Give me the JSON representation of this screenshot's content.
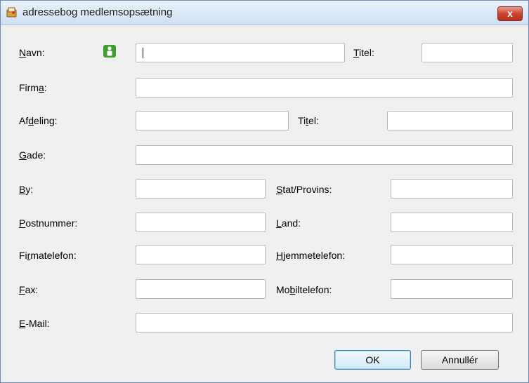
{
  "window": {
    "title": "adressebog medlemsopsætning",
    "close_label": "x"
  },
  "colors": {
    "titlebar": "#cfe0f3",
    "close": "#c9462f",
    "person_icon": "#3f9e2f",
    "ok_focus": "#3c7fb1"
  },
  "icons": {
    "app": "address-book-icon",
    "person": "person-icon"
  },
  "form": {
    "navn": {
      "label_pre": "",
      "label_key": "N",
      "label_post": "avn:",
      "value": ""
    },
    "titel1": {
      "label_pre": "",
      "label_key": "T",
      "label_post": "itel:",
      "value": ""
    },
    "firma": {
      "label_pre": "Firm",
      "label_key": "a",
      "label_post": ":",
      "value": ""
    },
    "afdeling": {
      "label_pre": "Af",
      "label_key": "d",
      "label_post": "eling:",
      "value": ""
    },
    "titel2": {
      "label_pre": "Ti",
      "label_key": "t",
      "label_post": "el:",
      "value": ""
    },
    "gade": {
      "label_pre": "",
      "label_key": "G",
      "label_post": "ade:",
      "value": ""
    },
    "by": {
      "label_pre": "",
      "label_key": "B",
      "label_post": "y:",
      "value": ""
    },
    "stat": {
      "label_pre": "",
      "label_key": "S",
      "label_post": "tat/Provins:",
      "value": ""
    },
    "postnummer": {
      "label_pre": "",
      "label_key": "P",
      "label_post": "ostnummer:",
      "value": ""
    },
    "land": {
      "label_pre": "",
      "label_key": "L",
      "label_post": "and:",
      "value": ""
    },
    "firmatelefon": {
      "label_pre": "Fi",
      "label_key": "r",
      "label_post": "matelefon:",
      "value": ""
    },
    "hjemmetelefon": {
      "label_pre": "",
      "label_key": "H",
      "label_post": "jemmetelefon:",
      "value": ""
    },
    "fax": {
      "label_pre": "",
      "label_key": "F",
      "label_post": "ax:",
      "value": ""
    },
    "mobiltelefon": {
      "label_pre": "Mo",
      "label_key": "b",
      "label_post": "iltelefon:",
      "value": ""
    },
    "email": {
      "label_pre": "",
      "label_key": "E",
      "label_post": "-Mail:",
      "value": ""
    }
  },
  "buttons": {
    "ok": "OK",
    "cancel": "Annullér"
  }
}
